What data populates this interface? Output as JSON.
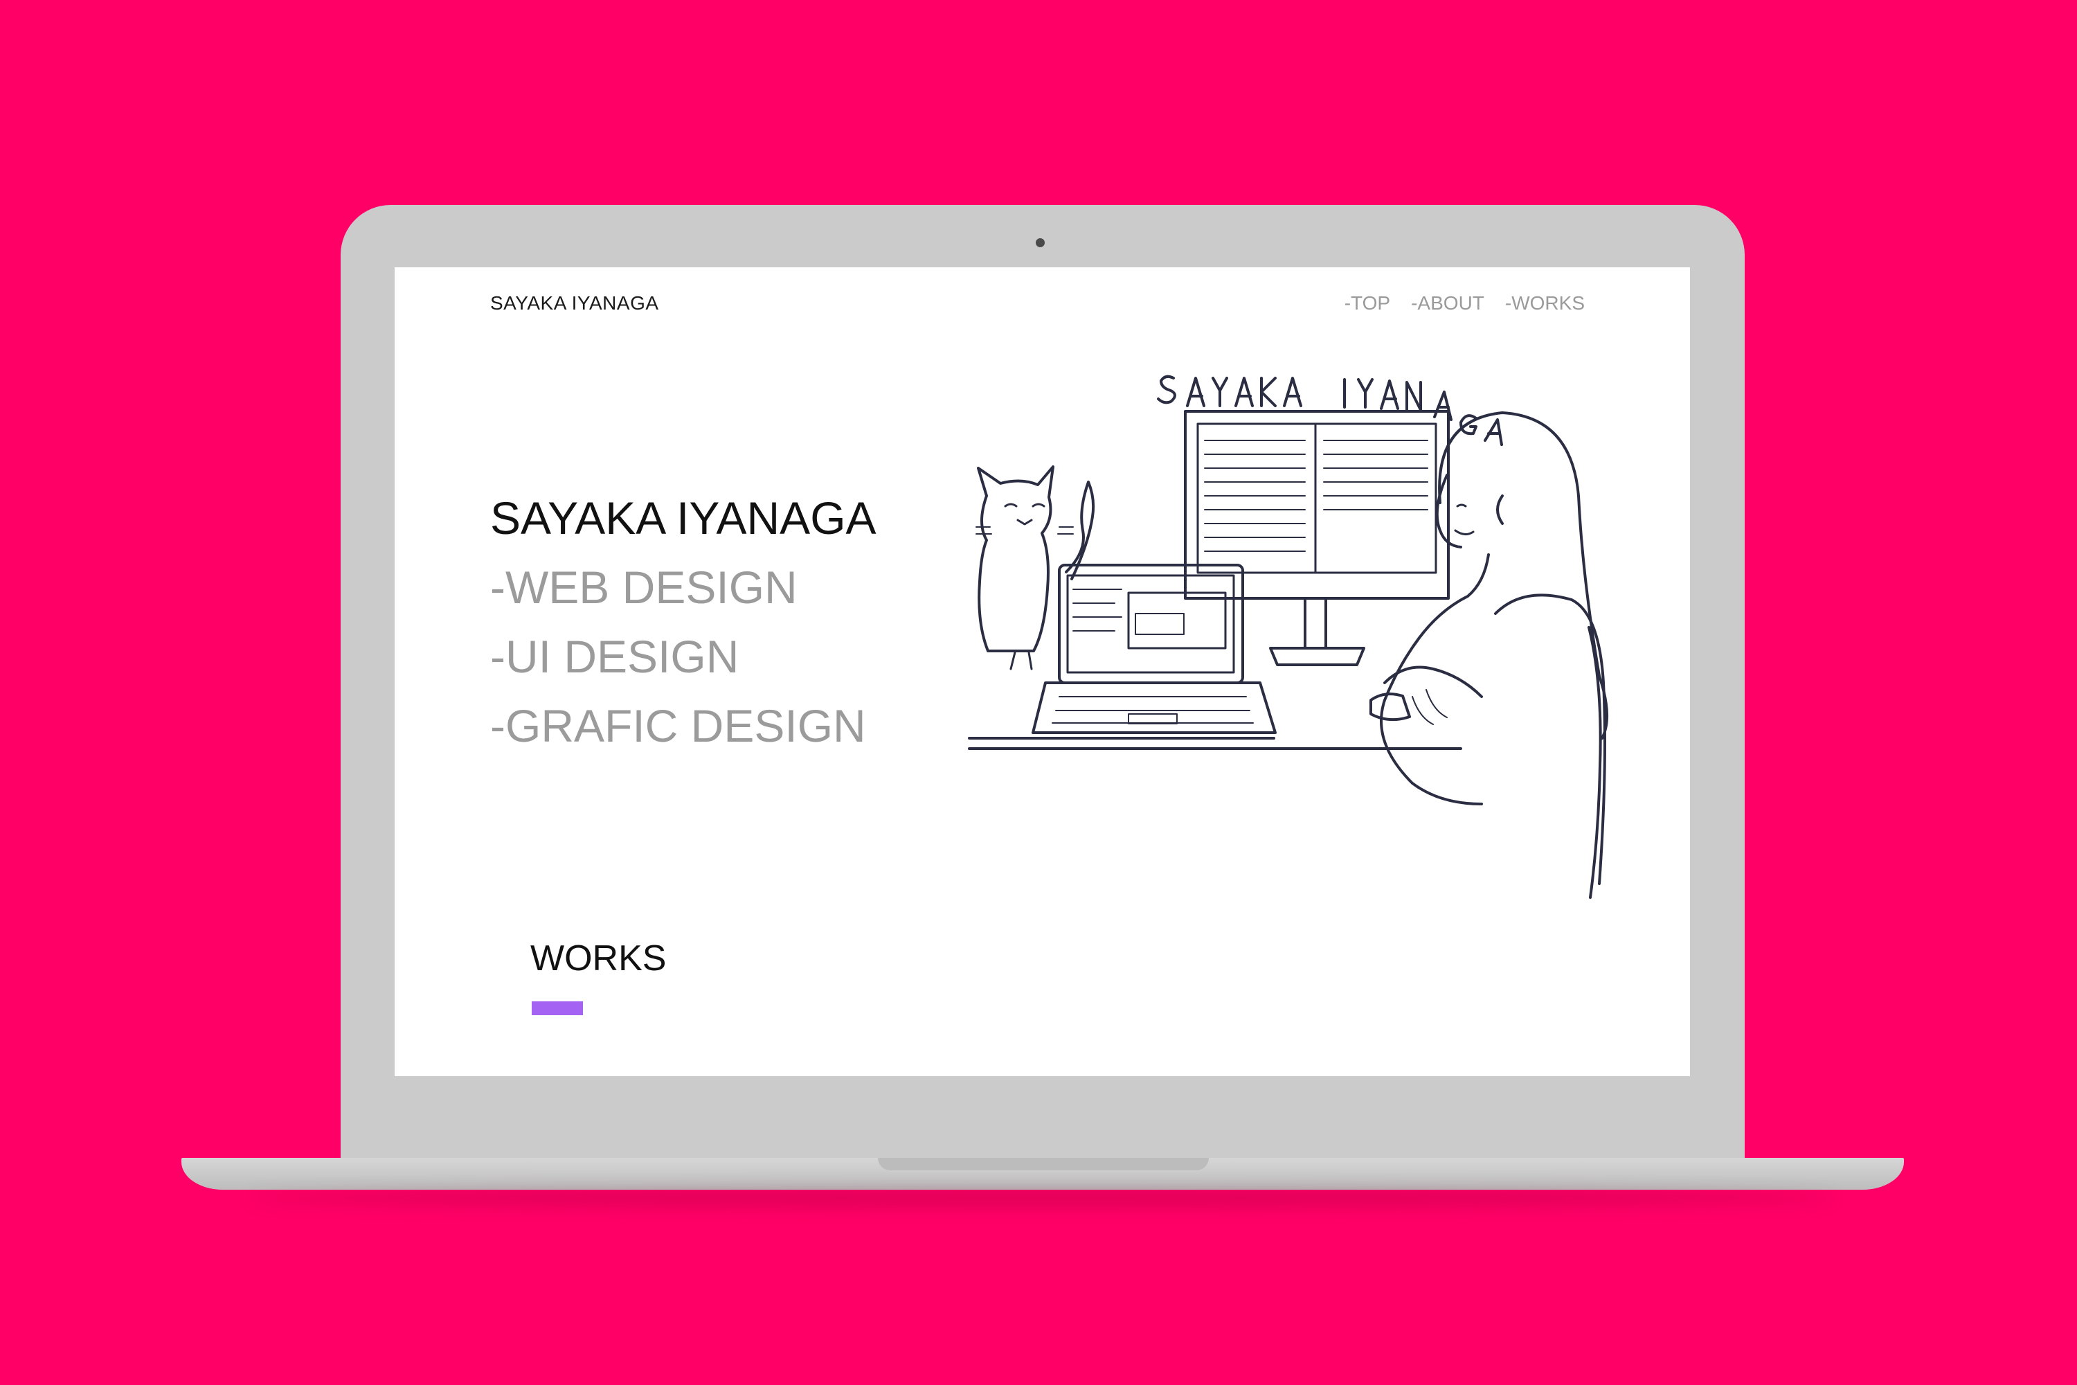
{
  "site": {
    "logo": "SAYAKA IYANAGA",
    "nav": [
      "-TOP",
      "-ABOUT",
      "-WORKS"
    ]
  },
  "hero": {
    "name": "SAYAKA IYANAGA",
    "lines": [
      "-WEB DESIGN",
      "-UI DESIGN",
      "-GRAFIC DESIGN"
    ]
  },
  "illustration": {
    "lettering": "SAYAKA IYANAGA"
  },
  "works": {
    "heading": "WORKS"
  },
  "colors": {
    "background": "#ff0066",
    "laptop": "#cbcbcb",
    "accent": "#a463f2",
    "ink": "#2b2d42"
  }
}
